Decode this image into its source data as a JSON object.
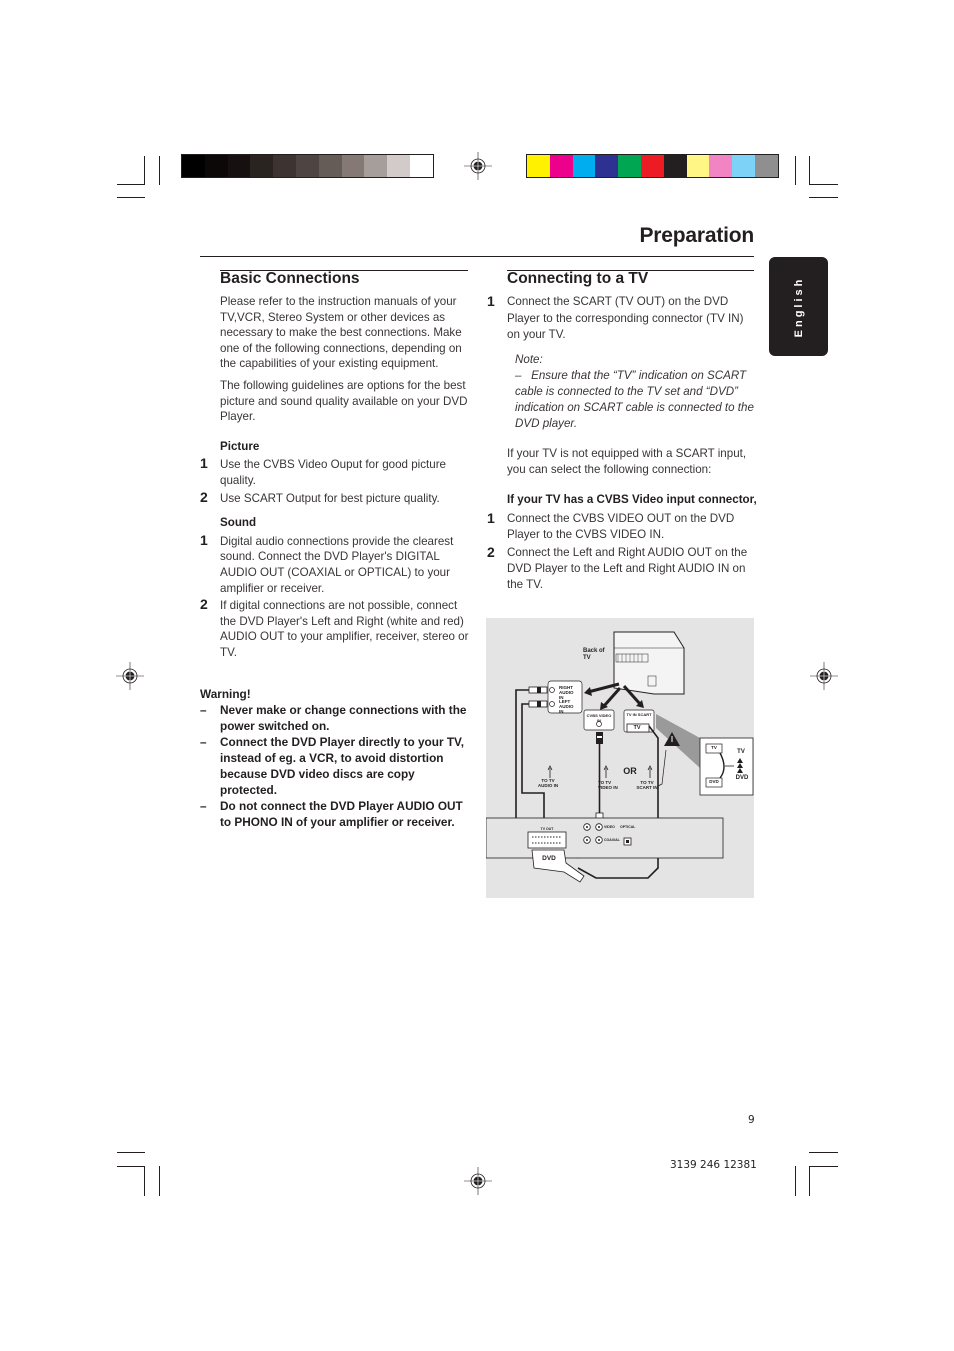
{
  "page": {
    "title": "Preparation",
    "language_tab": "English",
    "page_number": "9",
    "doc_code": "3139 246 12381"
  },
  "print_marks": {
    "gray_scale": [
      "#000000",
      "#0b0807",
      "#161110",
      "#2a2420",
      "#3d3330",
      "#4e4441",
      "#655b57",
      "#847974",
      "#a69e9b",
      "#d3cbca",
      "#ffffff"
    ],
    "color_bars": [
      "#fff100",
      "#ec008c",
      "#00aeef",
      "#2e3192",
      "#00a651",
      "#ed1c24",
      "#231f20",
      "#fff685",
      "#f384c3",
      "#7dd3f7",
      "#8f8f8f"
    ]
  },
  "basic": {
    "heading": "Basic Connections",
    "intro": [
      "Please refer to the instruction manuals of your TV,VCR, Stereo System or other devices as necessary to make the best connections. Make one of the following connections, depending on the capabilities of your existing equipment.",
      "The following guidelines are options for the best picture and sound quality available on your DVD Player."
    ],
    "picture": {
      "heading": "Picture",
      "steps": [
        {
          "num": "1",
          "text": "Use the CVBS Video Ouput for good picture quality."
        },
        {
          "num": "2",
          "text": "Use SCART Output for best picture quality."
        }
      ]
    },
    "sound": {
      "heading": "Sound",
      "steps": [
        {
          "num": "1",
          "text": "Digital audio connections provide the clearest sound. Connect the DVD Player's DIGITAL AUDIO OUT (COAXIAL or OPTICAL) to your amplifier or receiver."
        },
        {
          "num": "2",
          "text": "If digital connections are not possible, connect the DVD Player's Left and Right (white and red) AUDIO OUT to your amplifier, receiver, stereo or TV."
        }
      ]
    },
    "warning": {
      "heading": "Warning!",
      "items": [
        "Never make or change connections with the power switched on.",
        "Connect the DVD Player directly to your TV, instead of eg. a VCR,  to avoid distortion because DVD video discs are copy protected.",
        "Do not connect the DVD Player AUDIO OUT to PHONO IN of your amplifier or receiver."
      ]
    }
  },
  "tv": {
    "heading": "Connecting to a TV",
    "step1": {
      "num": "1",
      "text": "Connect the SCART (TV OUT) on the DVD Player to the corresponding connector (TV IN) on your TV."
    },
    "note_label": "Note:",
    "note_text": "Ensure that the “TV” indication on SCART cable is connected to the TV set and “DVD” indication on SCART cable is connected to the DVD player.",
    "alt_intro": "If your TV is not equipped with a SCART input, you can select the following connection:",
    "cvbs_heading": "If your TV has a CVBS Video input connector,",
    "cvbs_steps": [
      {
        "num": "1",
        "text": "Connect the CVBS VIDEO OUT on the DVD Player to the CVBS VIDEO IN."
      },
      {
        "num": "2",
        "text": "Connect the Left and Right AUDIO OUT on the DVD Player to the Left and Right AUDIO IN on the TV."
      }
    ]
  },
  "diagram": {
    "back_of_tv": "Back of TV",
    "right_audio_in": "RIGHT AUDIO IN",
    "left_audio_in": "LEFT AUDIO IN",
    "cvbs_video_in": "CVBS VIDEO IN",
    "tv_in_scart": "TV IN SCART",
    "tv_plug": "TV",
    "or_label": "OR",
    "to_tv_audio_in": "TO TV AUDIO IN",
    "to_tv_video_in": "TO TV VIDEO IN",
    "to_tv_scart_in": "TO TV SCART IN",
    "tv_out": "TV OUT",
    "video": "VIDEO",
    "optical": "OPTICAL",
    "coaxial": "COAXIAL",
    "dvd_plug": "DVD",
    "inset_tv": "TV",
    "inset_dvd": "DVD",
    "inset_plug_tv": "TV",
    "inset_plug_dvd": "DVD"
  }
}
